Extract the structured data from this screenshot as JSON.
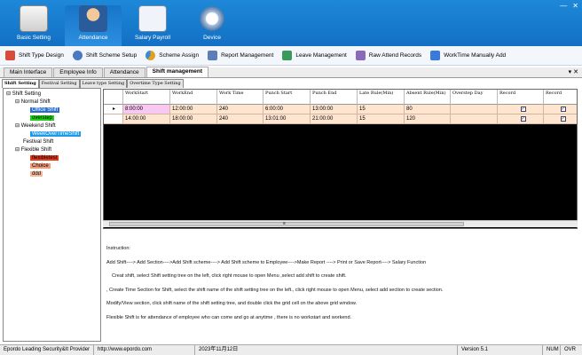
{
  "window": {
    "min": "—",
    "close": "✕"
  },
  "main_tabs": [
    {
      "label": "Basic Setting",
      "icon": "folder-icon"
    },
    {
      "label": "Attendance",
      "icon": "person-icon"
    },
    {
      "label": "Salary Payroll",
      "icon": "payroll-icon"
    },
    {
      "label": "Device",
      "icon": "device-icon"
    }
  ],
  "toolbar": [
    {
      "label": "Shift Type Design"
    },
    {
      "label": "Shift Scheme Setup"
    },
    {
      "label": "Scheme Assign"
    },
    {
      "label": "Report Management"
    },
    {
      "label": "Leave Management"
    },
    {
      "label": "Raw Attend Records"
    },
    {
      "label": "WorkTime Manually Add"
    }
  ],
  "doc_tabs": [
    "Main Interface",
    "Employee Info",
    "Attendance",
    "Shift management"
  ],
  "doc_close": "▾ ✕",
  "sub_tabs": [
    "Shift Setting",
    "Festival Setting",
    "Leave type Setting",
    "Overtime Type Setting"
  ],
  "tree": {
    "root": "Shift Setting",
    "normal": "Normal Shift",
    "office": "Office Shift",
    "overstep": "overstep",
    "weekend": "Weekend Shift",
    "weekover": "WeekOverTimeShift",
    "festival": "Festival Shift",
    "flexible": "Flexible Shift",
    "flexibletest": "flexibletest",
    "choice": "Choice",
    "ddd": "ddd"
  },
  "grid": {
    "columns": [
      "WorkStart",
      "WorkEnd",
      "Work Time",
      "Punch Start",
      "Punch End",
      "Late Rule(Min)",
      "Absent Rule(Min)",
      "Overstep Day",
      "Record",
      "Record"
    ],
    "row_marker": "▸",
    "rows": [
      {
        "c0": "8:00:00",
        "c1": "12:00:00",
        "c2": "240",
        "c3": "6:00:00",
        "c4": "13:00:00",
        "c5": "15",
        "c6": "80",
        "c7": "",
        "r1": "✓",
        "r2": "✓"
      },
      {
        "c0": "14:00:00",
        "c1": "18:00:00",
        "c2": "240",
        "c3": "13:01:00",
        "c4": "21:00:00",
        "c5": "15",
        "c6": "120",
        "c7": "",
        "r1": "✓",
        "r2": "✓"
      }
    ],
    "scroll_mark": "≡"
  },
  "instruction": {
    "title": "Instruction:",
    "l1": "Add Shift----> Add Section---->Add Shift scheme----> Add Shift scheme to Employee---->Make Report ----> Print or Save Report----> Salary Function",
    "l2": "Creat shift, select Shift setting tree on the left, click right mouse to open Menu ,select add shift to create shift.",
    "l3": ", Create Time Section for Shift, select the shift name of the shift setting tree on the left., click right mouse to open Menu, select add section to create section.",
    "l4": "Modify/View section, click shift name of the shift setting tree, and double click the grid cell on the above grid window.",
    "l5": "Flexible Shift is for attendance of employee who can come and go at anytime , there is no workstart and workend."
  },
  "status": {
    "company": "Epordo Leading Security&It Provider",
    "url": "http://www.epordo.com",
    "date": "2023年11月12日",
    "version": "Version 5.1",
    "num": "NUM",
    "ovr": "OVR"
  }
}
